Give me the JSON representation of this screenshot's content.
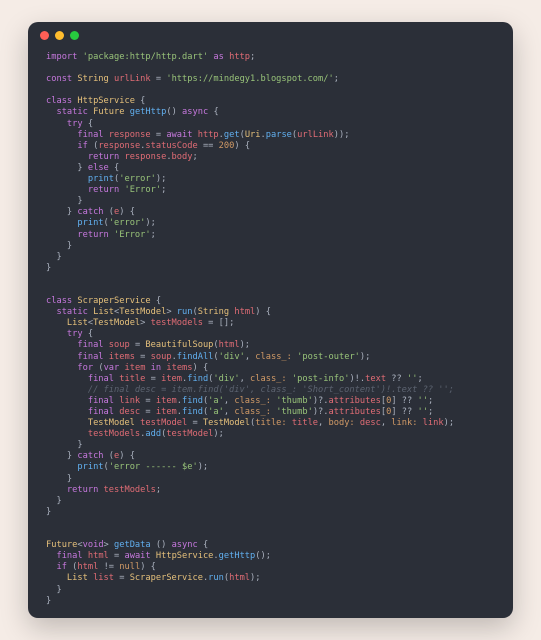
{
  "window": {
    "dots": {
      "red": "#ff5f56",
      "yellow": "#ffbd2e",
      "green": "#27c93f"
    }
  },
  "code": {
    "import_kw": "import",
    "import_pkg": "'package:http/http.dart'",
    "as_kw": "as",
    "http_alias": "http",
    "const_kw": "const",
    "string_type": "String",
    "urlLink_id": "urlLink",
    "urlLink_val": "'https://mindegy1.blogspot.com/'",
    "class_kw": "class",
    "HttpService": "HttpService",
    "static_kw": "static",
    "Future_t": "Future",
    "getHttp_fn": "getHttp",
    "async_kw": "async",
    "try_kw": "try",
    "final_kw": "final",
    "response_id": "response",
    "await_kw": "await",
    "httpget": "http.get",
    "Uri_t": "Uri",
    "parse_fn": "parse",
    "urlLink_ref": "urlLink",
    "if_kw": "if",
    "statusCode": "statusCode",
    "eq200": "200",
    "return_kw": "return",
    "body_prop": "body",
    "else_kw": "else",
    "print_fn": "print",
    "err_str": "'error'",
    "Error_str": "'Error'",
    "catch_kw": "catch",
    "e_id": "e",
    "ScraperService": "ScraperService",
    "List_t": "List",
    "TestModel_t": "TestModel",
    "run_fn": "run",
    "html_id": "html",
    "testModels_id": "testModels",
    "empty_arr": "[]",
    "soup_id": "soup",
    "BeautifulSoup": "BeautifulSoup",
    "items_id": "items",
    "findAll_fn": "findAll",
    "div_str": "'div'",
    "class_named": "class_:",
    "post_outer": "'post-outer'",
    "for_kw": "for",
    "var_kw": "var",
    "item_id": "item",
    "in_kw": "in",
    "title_id": "title",
    "find_fn": "find",
    "post_info": "'post-info'",
    "text_prop": "text",
    "nullish": "??",
    "empty_str": "''",
    "comment_desc": "// final desc = item.find('div', class_: 'Short_content')!.text ?? '';",
    "link_id": "link",
    "a_str": "'a'",
    "thumb_str": "'thumb'",
    "attributes": "attributes",
    "idx0": "0",
    "desc_id": "desc",
    "testModel_id": "testModel",
    "title_named": "title:",
    "body_named": "body:",
    "link_named": "link:",
    "add_fn": "add",
    "err_template": "'error ------ $e'",
    "void_t": "void",
    "getData_fn": "getData",
    "HttpServ_ref": "HttpService",
    "notnull": "null",
    "list_id": "list",
    "ScraperServ_ref": "ScraperService"
  }
}
